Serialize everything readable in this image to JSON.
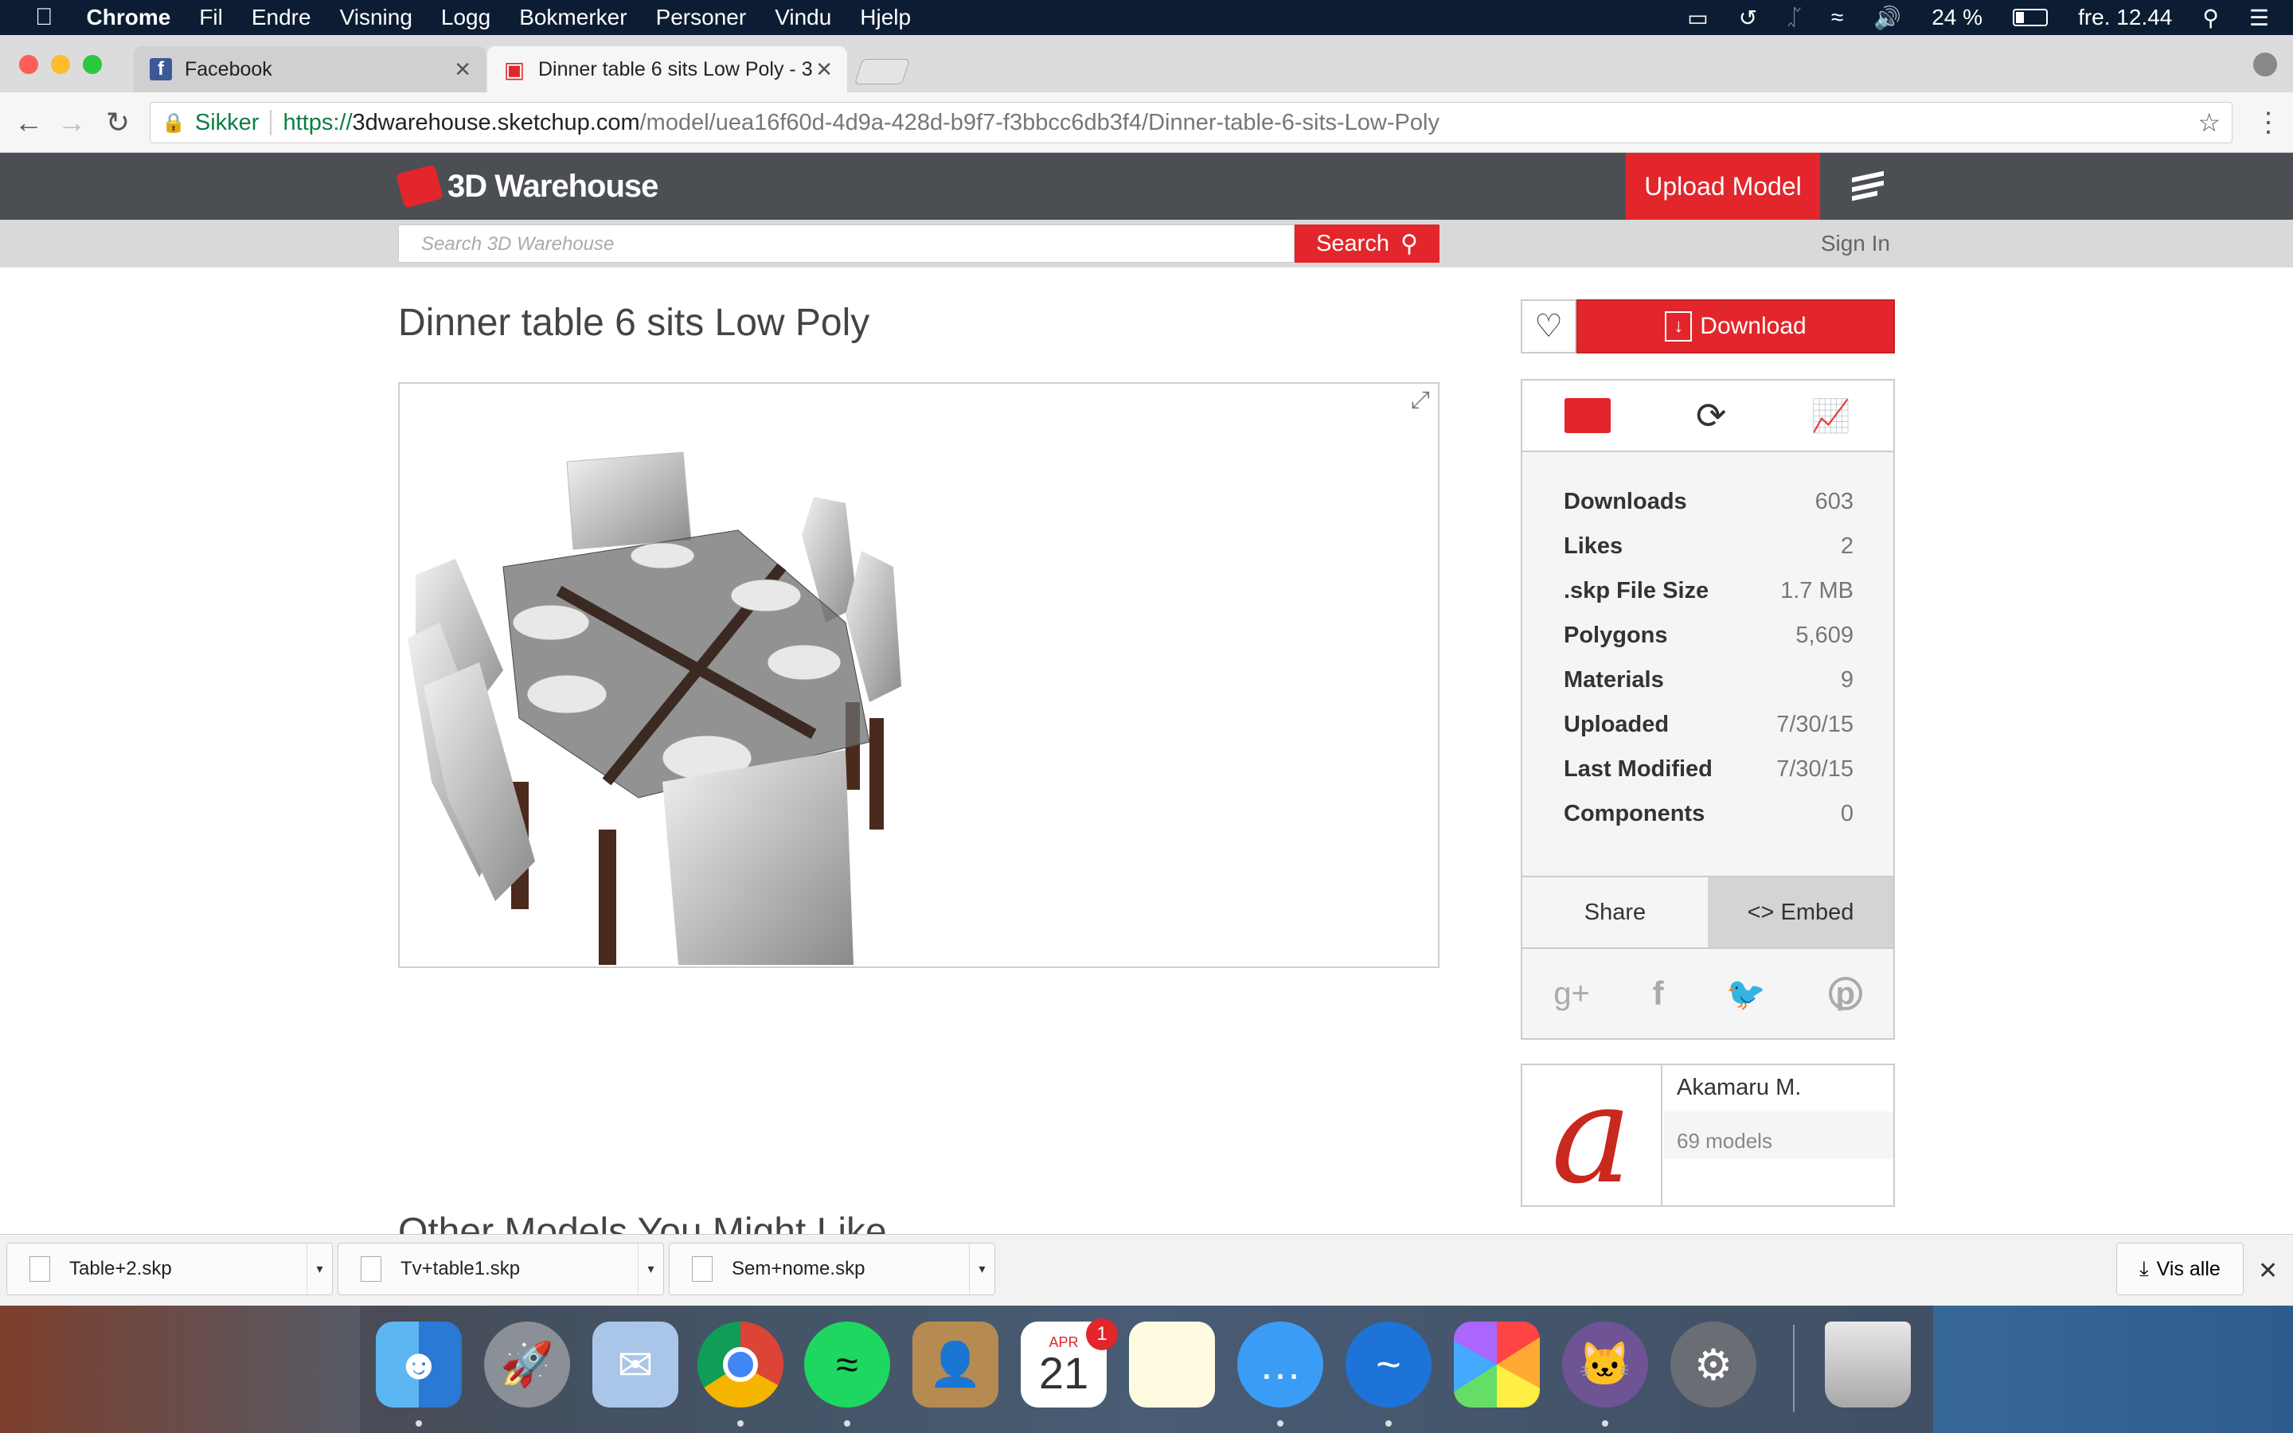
{
  "menubar": {
    "app": "Chrome",
    "items": [
      "Fil",
      "Endre",
      "Visning",
      "Logg",
      "Bokmerker",
      "Personer",
      "Vindu",
      "Hjelp"
    ],
    "battery": "24 %",
    "clock": "fre. 12.44"
  },
  "tabs": [
    {
      "title": "Facebook"
    },
    {
      "title": "Dinner table 6 sits Low Poly - 3"
    }
  ],
  "address": {
    "secure_label": "Sikker",
    "url_scheme": "https://",
    "url_host": "3dwarehouse.sketchup.com",
    "url_path": "/model/uea16f60d-4d9a-428d-b9f7-f3bbcc6db3f4/Dinner-table-6-sits-Low-Poly"
  },
  "site": {
    "logo": "3D Warehouse",
    "upload": "Upload Model",
    "search_placeholder": "Search 3D Warehouse",
    "search_button": "Search",
    "sign_in": "Sign In"
  },
  "model": {
    "title": "Dinner table 6 sits Low Poly",
    "download": "Download"
  },
  "stats": [
    {
      "k": "Downloads",
      "v": "603"
    },
    {
      "k": "Likes",
      "v": "2"
    },
    {
      "k": ".skp File Size",
      "v": "1.7 MB"
    },
    {
      "k": "Polygons",
      "v": "5,609"
    },
    {
      "k": "Materials",
      "v": "9"
    },
    {
      "k": "Uploaded",
      "v": "7/30/15"
    },
    {
      "k": "Last Modified",
      "v": "7/30/15"
    },
    {
      "k": "Components",
      "v": "0"
    }
  ],
  "share": {
    "share": "Share",
    "embed": "<> Embed"
  },
  "author": {
    "name": "Akamaru M.",
    "models": "69 models"
  },
  "other_heading": "Other Models You Might Like",
  "downloads_shelf": {
    "files": [
      "Table+2.skp",
      "Tv+table1.skp",
      "Sem+nome.skp"
    ],
    "show_all": "Vis alle"
  },
  "dock": {
    "calendar_month": "APR",
    "calendar_day": "21",
    "calendar_badge": "1"
  },
  "colors": {
    "accent": "#e2262b",
    "header": "#4b4f54"
  }
}
